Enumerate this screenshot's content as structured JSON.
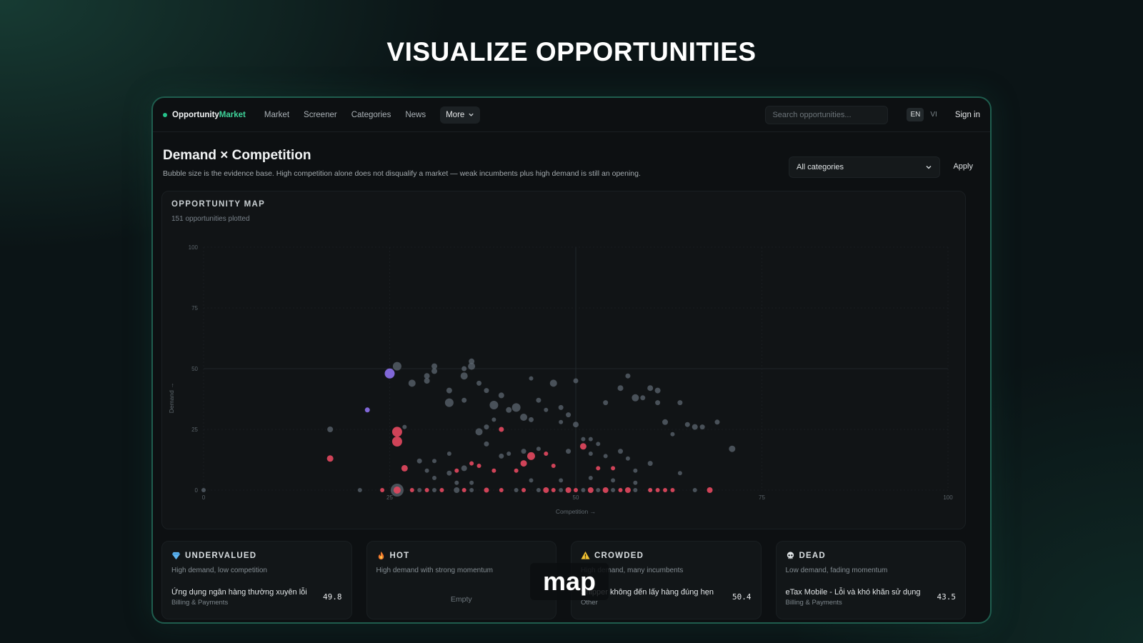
{
  "headline": "VISUALIZE OPPORTUNITIES",
  "nav": {
    "brand_part1": "Opportunity",
    "brand_part2": "Market",
    "links": [
      "Market",
      "Screener",
      "Categories",
      "News"
    ],
    "more_label": "More",
    "search_placeholder": "Search opportunities...",
    "lang_en": "EN",
    "lang_vi": "VI",
    "signin": "Sign in"
  },
  "header": {
    "title": "Demand × Competition",
    "subtitle": "Bubble size is the evidence base. High competition alone does not disqualify a market — weak incumbents plus high demand is still an opening.",
    "filter_value": "All categories",
    "apply_label": "Apply"
  },
  "map": {
    "title": "OPPORTUNITY MAP",
    "subtitle": "151 opportunities plotted"
  },
  "colors": {
    "hot": "#e0485e",
    "undervalued": "#8a6fe8",
    "neutral": "#5c6570",
    "accent": "#3fd39a"
  },
  "chart_data": {
    "type": "scatter",
    "xlabel": "Competition →",
    "ylabel": "Demand →",
    "xlim": [
      0,
      100
    ],
    "ylim": [
      0,
      100
    ],
    "x_ticks": [
      "0",
      "25",
      "50",
      "75",
      "100"
    ],
    "y_ticks": [
      "0",
      "25",
      "50",
      "75",
      "100"
    ],
    "grid": true,
    "series": [
      {
        "group": "undervalued",
        "points": [
          [
            25,
            48,
            7
          ],
          [
            22,
            33,
            3.5
          ]
        ]
      },
      {
        "group": "hot",
        "points": [
          [
            17,
            13,
            4.5
          ],
          [
            26,
            24,
            7
          ],
          [
            26,
            20,
            7
          ],
          [
            27,
            9,
            4.5
          ],
          [
            40,
            25,
            3.5
          ],
          [
            44,
            14,
            5.5
          ],
          [
            46,
            15,
            3
          ],
          [
            51,
            18,
            4.5
          ],
          [
            37,
            10,
            3
          ],
          [
            39,
            8,
            3
          ],
          [
            34,
            8,
            3
          ],
          [
            36,
            11,
            3
          ],
          [
            42,
            8,
            3
          ],
          [
            43,
            11,
            4.5
          ],
          [
            47,
            10,
            3
          ],
          [
            53,
            9,
            3
          ],
          [
            55,
            9,
            3
          ],
          [
            24,
            0,
            3
          ],
          [
            26,
            0,
            5
          ],
          [
            28,
            0,
            3
          ],
          [
            30,
            0,
            3
          ],
          [
            32,
            0,
            3
          ],
          [
            35,
            0,
            3
          ],
          [
            38,
            0,
            3.5
          ],
          [
            40,
            0,
            3
          ],
          [
            43,
            0,
            3
          ],
          [
            46,
            0,
            4
          ],
          [
            47,
            0,
            3
          ],
          [
            49,
            0,
            4
          ],
          [
            50,
            0,
            3
          ],
          [
            52,
            0,
            4
          ],
          [
            54,
            0,
            4
          ],
          [
            56,
            0,
            3
          ],
          [
            57,
            0,
            4
          ],
          [
            60,
            0,
            3
          ],
          [
            61,
            0,
            3
          ],
          [
            62,
            0,
            3
          ],
          [
            63,
            0,
            3
          ],
          [
            68,
            0,
            4
          ]
        ]
      },
      {
        "group": "neutral",
        "points": [
          [
            17,
            25,
            4
          ],
          [
            28,
            44,
            5
          ],
          [
            26,
            51,
            6
          ],
          [
            30,
            47,
            4
          ],
          [
            31,
            51,
            4
          ],
          [
            31,
            49,
            4
          ],
          [
            33,
            36,
            6
          ],
          [
            33,
            41,
            4
          ],
          [
            35,
            37,
            3.5
          ],
          [
            35,
            47,
            5
          ],
          [
            36,
            53,
            4
          ],
          [
            36,
            51,
            5
          ],
          [
            37,
            44,
            3.5
          ],
          [
            38,
            41,
            3.5
          ],
          [
            39,
            35,
            6
          ],
          [
            38,
            26,
            3.5
          ],
          [
            40,
            39,
            4
          ],
          [
            41,
            33,
            4
          ],
          [
            42,
            34,
            6
          ],
          [
            43,
            30,
            5
          ],
          [
            44,
            29,
            3.5
          ],
          [
            45,
            37,
            3.5
          ],
          [
            47,
            44,
            5
          ],
          [
            48,
            34,
            3.5
          ],
          [
            49,
            31,
            3.5
          ],
          [
            48,
            28,
            3
          ],
          [
            50,
            27,
            4
          ],
          [
            51,
            21,
            3
          ],
          [
            52,
            21,
            3
          ],
          [
            53,
            19,
            3
          ],
          [
            54,
            36,
            3.5
          ],
          [
            58,
            38,
            5
          ],
          [
            59,
            38,
            3.5
          ],
          [
            60,
            42,
            4
          ],
          [
            61,
            41,
            4
          ],
          [
            61,
            36,
            3.5
          ],
          [
            62,
            28,
            4
          ],
          [
            63,
            23,
            3
          ],
          [
            64,
            36,
            3.5
          ],
          [
            65,
            27,
            3.5
          ],
          [
            66,
            26,
            4
          ],
          [
            67,
            26,
            3.5
          ],
          [
            71,
            17,
            4.5
          ],
          [
            69,
            28,
            3.5
          ],
          [
            56,
            42,
            4
          ],
          [
            37,
            24,
            5
          ],
          [
            38,
            19,
            3.5
          ],
          [
            40,
            14,
            3.5
          ],
          [
            41,
            15,
            3
          ],
          [
            43,
            16,
            3.5
          ],
          [
            45,
            17,
            3
          ],
          [
            49,
            16,
            3.5
          ],
          [
            52,
            15,
            3
          ],
          [
            54,
            14,
            3
          ],
          [
            56,
            16,
            3.5
          ],
          [
            57,
            13,
            3
          ],
          [
            60,
            11,
            3.5
          ],
          [
            58,
            8,
            3
          ],
          [
            64,
            7,
            3
          ],
          [
            33,
            7,
            3.5
          ],
          [
            35,
            9,
            4
          ],
          [
            31,
            12,
            3
          ],
          [
            33,
            15,
            3
          ],
          [
            29,
            12,
            3.5
          ],
          [
            30,
            8,
            3
          ],
          [
            31,
            5,
            3
          ],
          [
            34,
            3,
            3
          ],
          [
            36,
            3,
            3
          ],
          [
            44,
            4,
            3
          ],
          [
            48,
            4,
            3
          ],
          [
            52,
            5,
            3
          ],
          [
            55,
            4,
            3
          ],
          [
            58,
            3,
            3
          ],
          [
            21,
            0,
            3
          ],
          [
            29,
            0,
            3
          ],
          [
            31,
            0,
            3
          ],
          [
            34,
            0,
            4
          ],
          [
            36,
            0,
            3
          ],
          [
            42,
            0,
            3
          ],
          [
            45,
            0,
            3
          ],
          [
            48,
            0,
            3
          ],
          [
            51,
            0,
            3
          ],
          [
            53,
            0,
            3
          ],
          [
            55,
            0,
            3
          ],
          [
            58,
            0,
            3
          ],
          [
            60,
            0,
            3
          ],
          [
            66,
            0,
            3
          ],
          [
            0,
            0,
            3
          ],
          [
            26,
            0,
            9
          ],
          [
            30,
            45,
            4
          ],
          [
            35,
            50,
            3.5
          ],
          [
            44,
            46,
            3
          ],
          [
            50,
            45,
            3.5
          ],
          [
            57,
            47,
            3.5
          ],
          [
            27,
            26,
            3
          ],
          [
            46,
            33,
            3
          ],
          [
            39,
            29,
            3
          ]
        ]
      }
    ]
  },
  "cards": [
    {
      "title": "UNDERVALUED",
      "icon": "diamond-icon",
      "desc": "High demand, low competition",
      "item_title": "Ứng dụng ngân hàng thường xuyên lỗi",
      "item_cat": "Billing & Payments",
      "score": "49.8"
    },
    {
      "title": "HOT",
      "icon": "flame-icon",
      "desc": "High demand with strong momentum",
      "empty": "Empty"
    },
    {
      "title": "CROWDED",
      "icon": "warning-icon",
      "desc": "High demand, many incumbents",
      "item_title": "Shipper không đến lấy hàng đúng hẹn",
      "item_cat": "Other",
      "score": "50.4"
    },
    {
      "title": "DEAD",
      "icon": "skull-icon",
      "desc": "Low demand, fading momentum",
      "item_title": "eTax Mobile - Lỗi và khó khăn sử dụng",
      "item_cat": "Billing & Payments",
      "score": "43.5"
    }
  ],
  "caption": "map"
}
